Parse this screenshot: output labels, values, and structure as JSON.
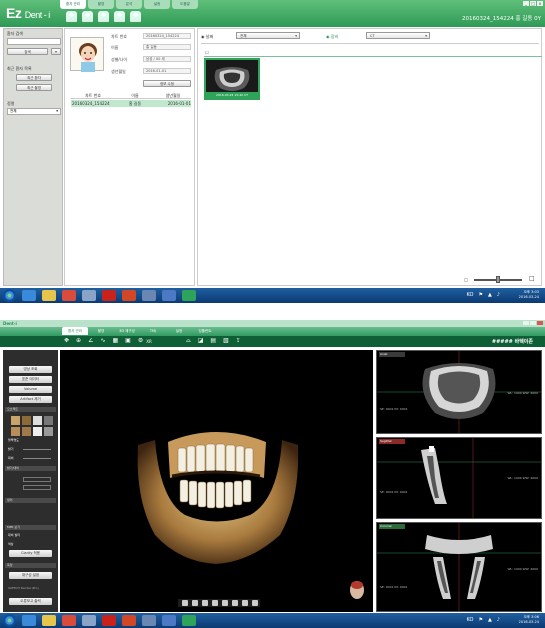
{
  "shot1": {
    "logo_main": "Ez",
    "logo_sub": "Dent - i",
    "tabs": [
      "환자 관리",
      "촬영",
      "분석",
      "설정",
      "도움말"
    ],
    "date_user": "20160324_154224 홍 길동 0Y",
    "left": {
      "search_label": "환자 검색",
      "search_button": "검색",
      "recent_label": "최근 환자 목록",
      "recent_button1": "최근 환자",
      "recent_button2": "최근 촬영",
      "sort_label": "정렬",
      "sort_value": "전체"
    },
    "patient": {
      "fields": [
        {
          "key": "차트 번호",
          "value": "20160324_154224"
        },
        {
          "key": "이름",
          "value": "홍 길동"
        },
        {
          "key": "성별/나이",
          "value": "남성 / 00 세"
        },
        {
          "key": "생년월일",
          "value": "2016-01-01"
        }
      ],
      "edit_button": "정보 수정",
      "table_headers": [
        "차트 번호",
        "이름",
        "생년월일"
      ],
      "table_rows": [
        [
          "20160324_154224",
          "홍 길동",
          "2016-01-01"
        ]
      ]
    },
    "filter": {
      "radio1": "날짜",
      "select1": "전체",
      "radio2": "장비",
      "select2": "CT"
    },
    "thumbnail_caption": "2016-03-24 15:42 CT",
    "footer_marker": "□"
  },
  "shot2": {
    "title_logo": "Dent-i",
    "tabs": [
      "환자 관리",
      "촬영",
      "3D 재구성",
      "TMJ",
      "설정",
      "임플란트"
    ],
    "tool_label": "XR",
    "brand": "##### 바텍이존",
    "left": {
      "buttons": [
        "영상 조회",
        "표준 데이터",
        "Volume",
        "Artifact 제거"
      ],
      "headers": [
        "오브젝트",
        "밝기/대비",
        "컬러",
        "MPR 보기",
        "측정"
      ],
      "labels": [
        "불투명도",
        "밝기",
        "대비",
        "대비 필터",
        "색상"
      ],
      "bottom_buttons": [
        "Clarity 적용",
        "재구성 설정",
        "오류보고 출력"
      ],
      "footer_text": "VATECH Dental (Pro)"
    },
    "views": {
      "axial_label": "Axial",
      "sagittal_label": "Sagittal",
      "coronal_label": "Coronal",
      "overlay_top": "SE: 0001\nIM: 0001",
      "overlay_info": "WL: 1000\nWW: 4000"
    }
  },
  "taskbar": {
    "lang_top": "KO",
    "time1": "오후 3:03",
    "date1": "2016-03-24",
    "time2": "오후 3:06",
    "date2": "2016-03-24"
  },
  "colors": {
    "green_header": "#2e9a56",
    "toolbar_dark": "#0f5f36",
    "taskbar": "#0b3a72"
  }
}
